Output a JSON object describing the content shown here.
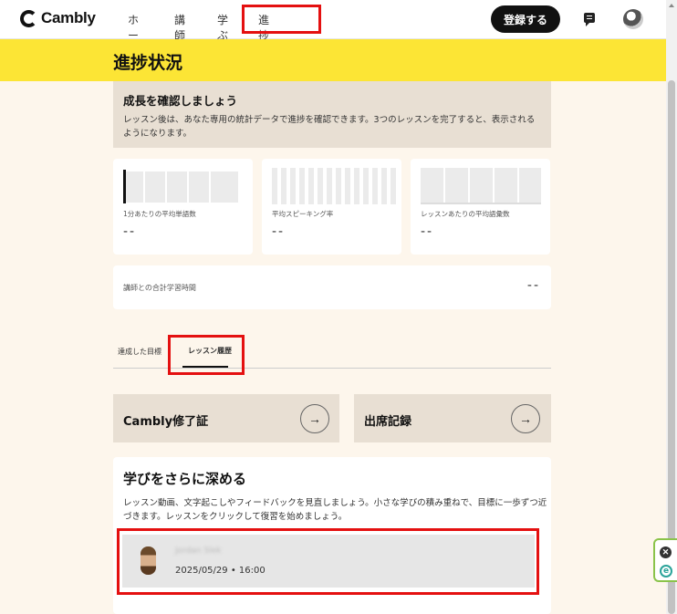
{
  "header": {
    "logo_text": "Cambly",
    "nav": {
      "home": "ホーム",
      "tutors": "講師",
      "learn": "学ぶ",
      "progress": "進捗状況"
    },
    "register_label": "登録する"
  },
  "page": {
    "title": "進捗状況"
  },
  "info": {
    "title": "成長を確認しましょう",
    "text": "レッスン後は、あなた専用の統計データで進捗を確認できます。3つのレッスンを完了すると、表示されるようになります。"
  },
  "stats": [
    {
      "label": "1分あたりの平均単語数",
      "value": "--"
    },
    {
      "label": "平均スピーキング率",
      "value": "--"
    },
    {
      "label": "レッスンあたりの平均語彙数",
      "value": "--"
    }
  ],
  "total": {
    "label": "講師との合計学習時間",
    "value": "--"
  },
  "tabs": {
    "goals": "達成した目標",
    "history": "レッスン履歴"
  },
  "links": {
    "certificate": "Cambly修了証",
    "attendance": "出席記録",
    "arrow": "→"
  },
  "deep": {
    "title": "学びをさらに深める",
    "text": "レッスン動画、文字起こしやフィードバックを見直しましょう。小さな学びの積み重ねで、目標に一歩ずつ近づきます。レッスンをクリックして復習を始めましょう。",
    "lesson": {
      "name": "Jordan Slek",
      "date": "2025/05/29 • 16:00"
    }
  },
  "side": {
    "close": "✕",
    "e": "e"
  },
  "colors": {
    "banner": "#fce535",
    "highlight": "#e41010",
    "page_bg": "#fdf6ec",
    "card_beige": "#e8dfd3"
  }
}
